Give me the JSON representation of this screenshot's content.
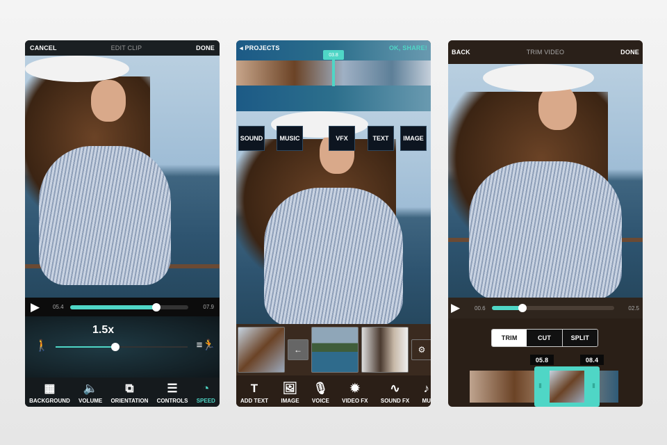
{
  "edit_clip": {
    "header": {
      "cancel": "CANCEL",
      "title": "EDIT CLIP",
      "done": "DONE"
    },
    "playback": {
      "current": "05.4",
      "end": "07.9",
      "progress": 0.73
    },
    "speed": {
      "value": "1.5x",
      "level": 0.45
    },
    "toolbar": [
      {
        "label": "BACKGROUND",
        "icon": "background-icon"
      },
      {
        "label": "VOLUME",
        "icon": "volume-icon"
      },
      {
        "label": "ORIENTATION",
        "icon": "orientation-icon"
      },
      {
        "label": "CONTROLS",
        "icon": "controls-icon"
      },
      {
        "label": "SPEED",
        "icon": "speed-icon",
        "active": true
      }
    ]
  },
  "project": {
    "header": {
      "back": "PROJECTS",
      "share": "OK, SHARE!"
    },
    "playhead": "03.8",
    "tracks": [
      "SOUND",
      "MUSIC",
      "VFX",
      "TEXT",
      "IMAGE"
    ],
    "toolbar": [
      {
        "label": "ADD TEXT",
        "icon": "text-icon"
      },
      {
        "label": "IMAGE",
        "icon": "image-icon"
      },
      {
        "label": "VOICE",
        "icon": "microphone-icon"
      },
      {
        "label": "VIDEO FX",
        "icon": "burst-icon"
      },
      {
        "label": "SOUND FX",
        "icon": "waveform-icon"
      },
      {
        "label": "MU",
        "icon": "music-icon"
      }
    ]
  },
  "trim": {
    "header": {
      "back": "BACK",
      "title": "TRIM VIDEO",
      "done": "DONE"
    },
    "playback": {
      "current": "00.6",
      "end": "02.5",
      "progress": 0.25
    },
    "modes": [
      "TRIM",
      "CUT",
      "SPLIT"
    ],
    "active_mode": "TRIM",
    "range": {
      "start": "05.8",
      "end": "08.4"
    }
  },
  "colors": {
    "accent": "#4fd6c6",
    "header_blue": "#1c5a86"
  }
}
